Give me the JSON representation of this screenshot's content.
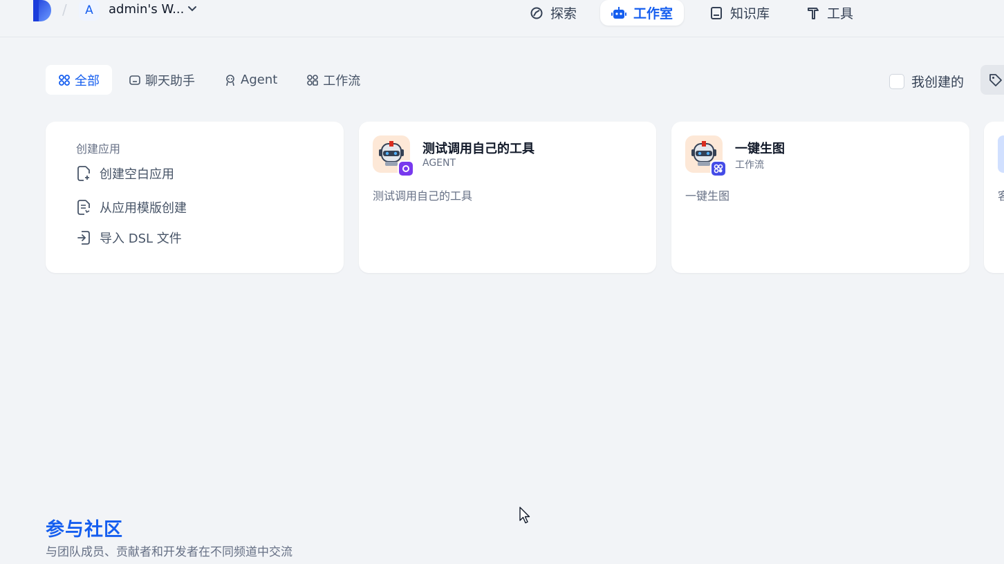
{
  "header": {
    "workspace_initial": "A",
    "workspace_name": "admin's W...",
    "nav": [
      {
        "label": "探索",
        "icon": "explore-icon",
        "active": false
      },
      {
        "label": "工作室",
        "icon": "robot-icon",
        "active": true
      },
      {
        "label": "知识库",
        "icon": "book-icon",
        "active": false
      },
      {
        "label": "工具",
        "icon": "hammer-icon",
        "active": false
      }
    ],
    "colors": {
      "accent": "#155eef",
      "background": "#f2f4f7"
    }
  },
  "filters": {
    "tabs": [
      {
        "label": "全部",
        "icon": "grid-icon",
        "active": true
      },
      {
        "label": "聊天助手",
        "icon": "chat-icon",
        "active": false
      },
      {
        "label": "Agent",
        "icon": "agent-icon",
        "active": false
      },
      {
        "label": "工作流",
        "icon": "workflow-icon",
        "active": false
      }
    ],
    "mine_label": "我创建的",
    "mine_checked": false,
    "tag_icon": "tag-icon"
  },
  "create_card": {
    "title": "创建应用",
    "items": [
      {
        "label": "创建空白应用",
        "icon": "new-file-icon"
      },
      {
        "label": "从应用模版创建",
        "icon": "template-icon"
      },
      {
        "label": "导入 DSL 文件",
        "icon": "import-icon"
      }
    ]
  },
  "apps": [
    {
      "name": "测试调用自己的工具",
      "type": "AGENT",
      "description": "测试调用自己的工具",
      "icon": "robot-avatar",
      "badge": "agent-badge-icon",
      "badge_color": "#7839ee"
    },
    {
      "name": "一键生图",
      "type": "工作流",
      "description": "一键生图",
      "icon": "robot-avatar",
      "badge": "workflow-badge-icon",
      "badge_color": "#444ce7"
    }
  ],
  "peek_card": {
    "text": "客"
  },
  "community": {
    "title": "参与社区",
    "subtitle": "与团队成员、贡献者和开发者在不同频道中交流"
  }
}
